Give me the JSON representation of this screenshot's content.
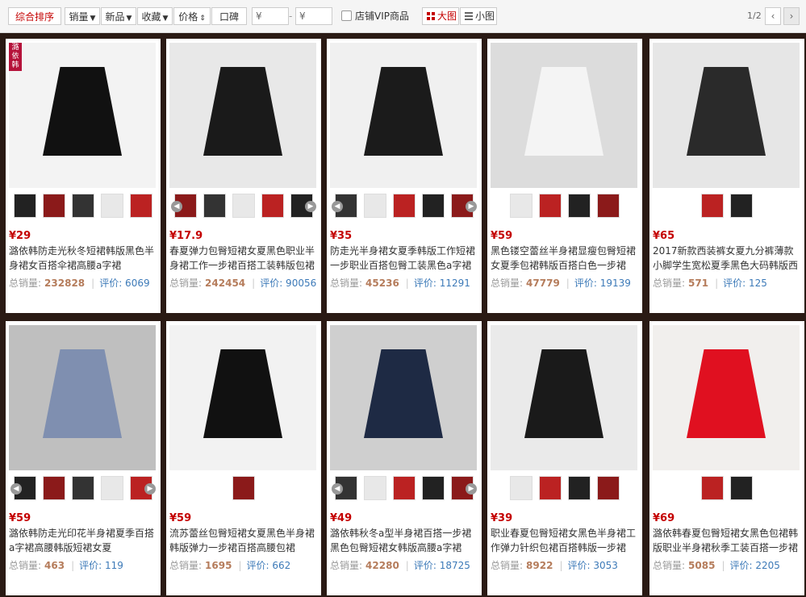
{
  "filters": {
    "sort_default": "综合排序",
    "sort_sales": "销量",
    "sort_new": "新品",
    "sort_fav": "收藏",
    "sort_price": "价格",
    "sort_reputation": "口碑",
    "price_min_placeholder": "¥",
    "price_max_placeholder": "¥",
    "price_separator": "-",
    "vip_label": "店铺VIP商品",
    "view_large": "大图",
    "view_small": "小图",
    "page_indicator": "1/2",
    "prev_label": "‹",
    "next_label": "›"
  },
  "labels": {
    "sales_label": "总销量:",
    "review_label": "评价:",
    "brand_tag": "潞依韩"
  },
  "colors": {
    "accent": "#c40000",
    "background": "#2a1a14",
    "review_link": "#3d7ab8"
  },
  "products": [
    {
      "price": "¥29",
      "title": "潞依韩防走光秋冬短裙韩版黑色半身裙女百搭伞裙高腰a字裙",
      "sales": "232828",
      "reviews": "评价: 6069",
      "thumbs": 5,
      "arrows": false
    },
    {
      "price": "¥17.9",
      "title": "春夏弹力包臀短裙女夏黑色职业半身裙工作一步裙百搭工装韩版包裙",
      "sales": "242454",
      "reviews": "评价: 90056",
      "thumbs": 5,
      "arrows": true
    },
    {
      "price": "¥35",
      "title": "防走光半身裙女夏季韩版工作短裙一步职业百搭包臀工装黑色a字裙",
      "sales": "45236",
      "reviews": "评价: 11291",
      "thumbs": 5,
      "arrows": true
    },
    {
      "price": "¥59",
      "title": "黑色镂空蕾丝半身裙显瘦包臀短裙女夏季包裙韩版百搭白色一步裙",
      "sales": "47779",
      "reviews": "评价: 19139",
      "thumbs": 4,
      "arrows": false
    },
    {
      "price": "¥65",
      "title": "2017新款西装裤女夏九分裤薄款小脚学生宽松夏季黑色大码韩版西",
      "sales": "571",
      "reviews": "评价: 125",
      "thumbs": 2,
      "arrows": false
    },
    {
      "price": "¥59",
      "title": "潞依韩防走光印花半身裙夏季百搭a字裙高腰韩版短裙女夏",
      "sales": "463",
      "reviews": "评价: 119",
      "thumbs": 5,
      "arrows": true
    },
    {
      "price": "¥59",
      "title": "流苏蕾丝包臀短裙女夏黑色半身裙韩版弹力一步裙百搭高腰包裙",
      "sales": "1695",
      "reviews": "评价: 662",
      "thumbs": 1,
      "arrows": false
    },
    {
      "price": "¥49",
      "title": "潞依韩秋冬a型半身裙百搭一步裙黑色包臀短裙女韩版高腰a字裙",
      "sales": "42280",
      "reviews": "评价: 18725",
      "thumbs": 5,
      "arrows": true
    },
    {
      "price": "¥39",
      "title": "职业春夏包臀短裙女黑色半身裙工作弹力针织包裙百搭韩版一步裙",
      "sales": "8922",
      "reviews": "评价: 3053",
      "thumbs": 4,
      "arrows": false
    },
    {
      "price": "¥69",
      "title": "潞依韩春夏包臀短裙女黑色包裙韩版职业半身裙秋季工装百搭一步裙",
      "sales": "5085",
      "reviews": "评价: 2205",
      "thumbs": 2,
      "arrows": false
    }
  ]
}
